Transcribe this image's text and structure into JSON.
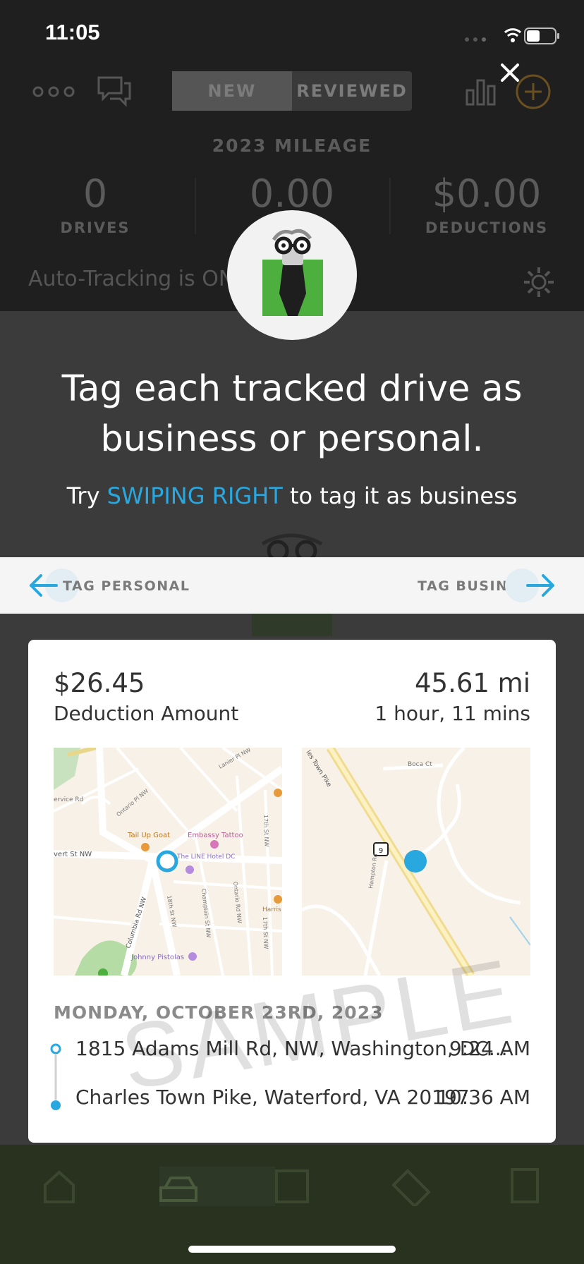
{
  "status": {
    "time": "11:05"
  },
  "background_app": {
    "tabs": [
      "NEW",
      "REVIEWED"
    ],
    "mileage_title": "2023 MILEAGE",
    "stats": [
      {
        "value": "0",
        "label": "DRIVES"
      },
      {
        "value": "0.00",
        "label": ""
      },
      {
        "value": "$0.00",
        "label": "DEDUCTIONS"
      }
    ],
    "auto_tracking": "Auto-Tracking is ON"
  },
  "overlay": {
    "headline_line1": "Tag each tracked drive as",
    "headline_line2": "business or personal.",
    "sub_prefix": "Try ",
    "sub_highlight": "SWIPING RIGHT",
    "sub_suffix": " to tag it as business",
    "tag_personal": "TAG PERSONAL",
    "tag_business": "TAG BUSINESS"
  },
  "card": {
    "amount": "$26.45",
    "amount_label": "Deduction Amount",
    "distance": "45.61 mi",
    "duration": "1 hour, 11 mins",
    "date": "MONDAY, OCTOBER 23RD, 2023",
    "start": {
      "address": "1815 Adams Mill Rd, NW, Washington, DC...",
      "time": "9:24 AM"
    },
    "end": {
      "address": "Charles Town Pike, Waterford, VA 20197",
      "time": "10:36 AM"
    },
    "watermark": "SAMPLE",
    "map_start_labels": {
      "tail_up_goat": "Tail Up Goat",
      "embassy_tattoo": "Embassy Tattoo",
      "line_hotel": "The LINE Hotel DC",
      "columbia": "Columbia Rd NW",
      "johnny": "Johnny Pistolas",
      "st18": "18th St NW",
      "champlain": "Champlain St NW",
      "ontario": "Ontario Rd NW",
      "st17": "17th St NW",
      "kalorama": "vert St NW",
      "lanier": "Lanier Pl NW",
      "ontario_pl": "Ontario Pl NW",
      "service": "ervice Rd",
      "harris": "Harris"
    },
    "map_end_labels": {
      "pike": "les Town Pike",
      "boca": "Boca Ct",
      "hampton": "Hampton Rd",
      "route": "9"
    }
  },
  "colors": {
    "accent": "#29a8e0",
    "brand_green": "#4caf3e",
    "gold": "#c8902a"
  }
}
